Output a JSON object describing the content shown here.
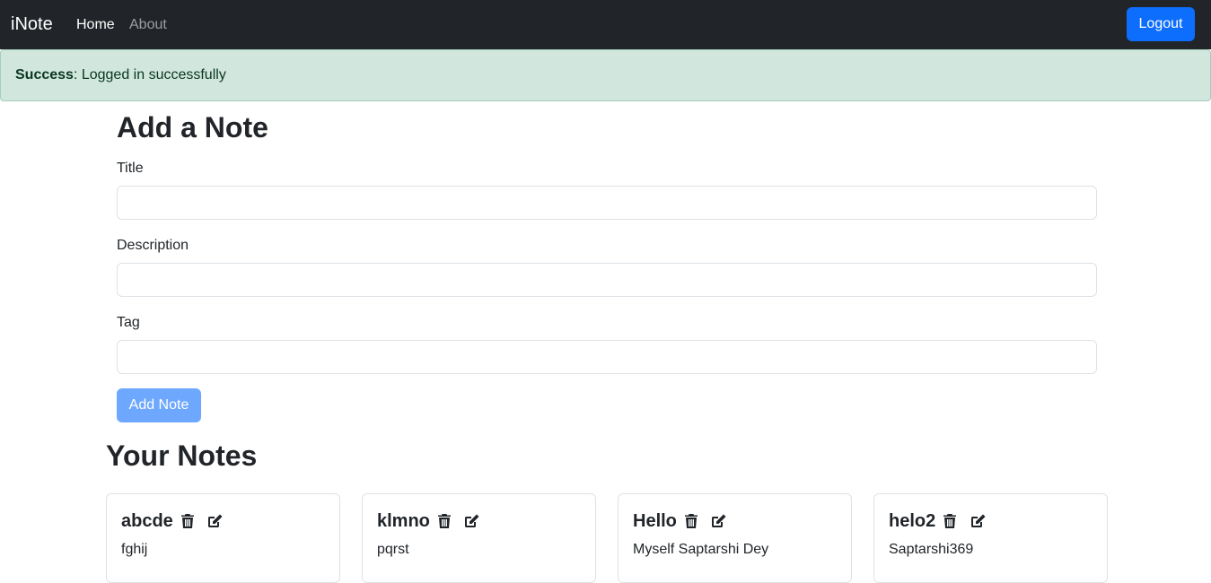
{
  "navbar": {
    "brand": "iNote",
    "links": [
      {
        "label": "Home",
        "active": true
      },
      {
        "label": "About",
        "active": false
      }
    ],
    "logout_label": "Logout"
  },
  "alert": {
    "type": "Success",
    "message": ": Logged in successfully"
  },
  "form": {
    "heading": "Add a Note",
    "title_label": "Title",
    "title_value": "",
    "description_label": "Description",
    "description_value": "",
    "tag_label": "Tag",
    "tag_value": "",
    "submit_label": "Add Note"
  },
  "notes_section": {
    "heading": "Your Notes",
    "notes": [
      {
        "title": "abcde",
        "description": "fghij"
      },
      {
        "title": "klmno",
        "description": "pqrst"
      },
      {
        "title": "Hello",
        "description": "Myself Saptarshi Dey"
      },
      {
        "title": "helo2",
        "description": "Saptarshi369"
      }
    ]
  },
  "icons": {
    "delete": "trash-icon",
    "edit": "edit-icon"
  },
  "colors": {
    "navbar_bg": "#212529",
    "primary": "#0d6efd",
    "primary_disabled": "#6ea8fe",
    "alert_success_bg": "#d1e7dd",
    "alert_success_text": "#0a3622"
  }
}
